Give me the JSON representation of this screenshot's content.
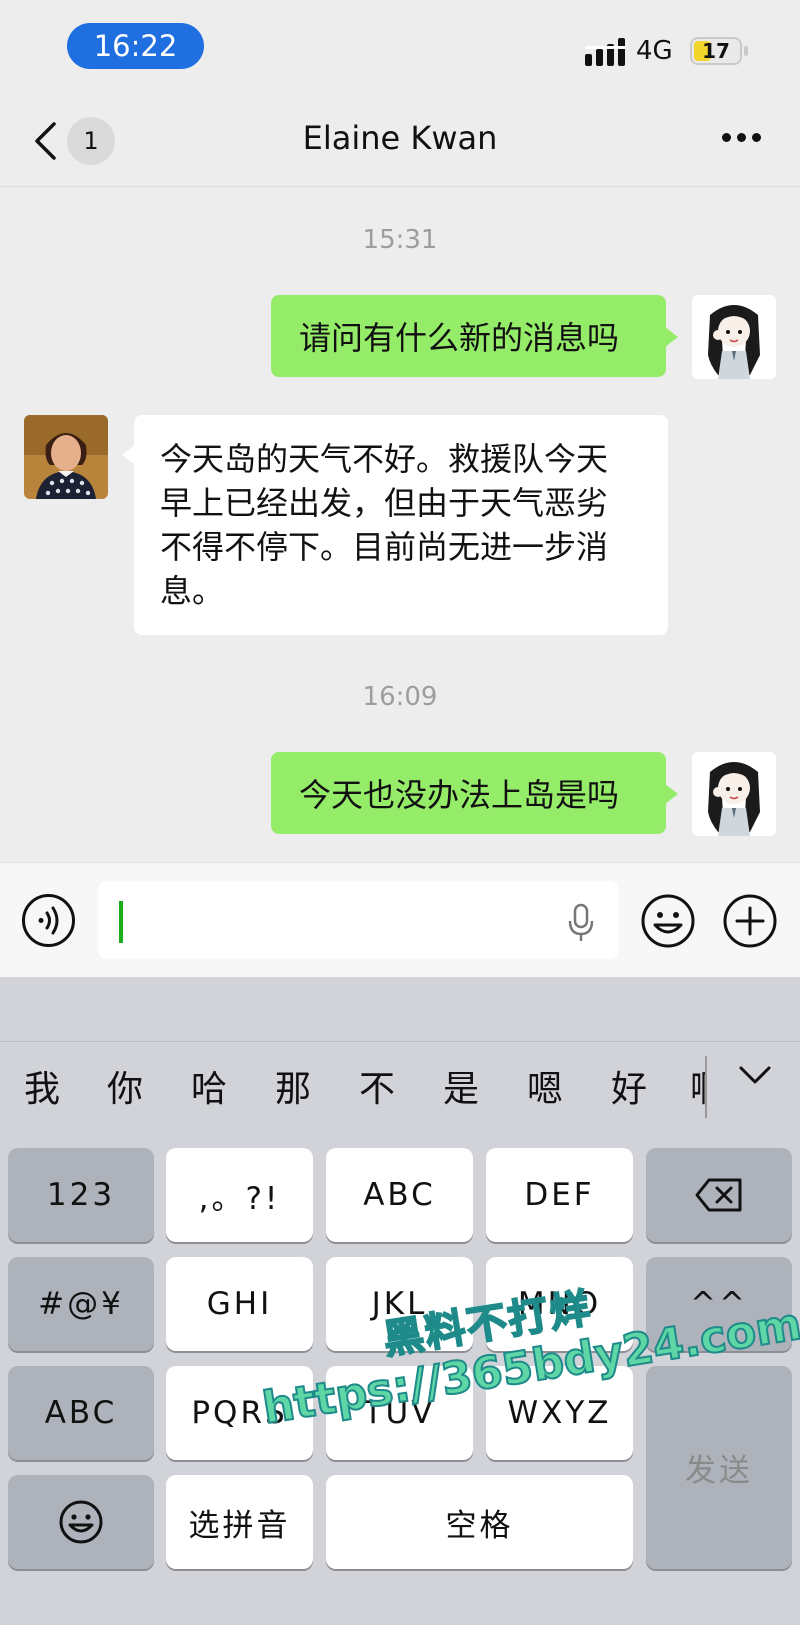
{
  "status_bar": {
    "time": "16:22",
    "network": "4G",
    "battery": "17"
  },
  "nav": {
    "unread_count": "1",
    "title": "Elaine Kwan"
  },
  "messages": [
    {
      "type": "timestamp",
      "text": "15:31"
    },
    {
      "type": "outgoing",
      "text": "请问有什么新的消息吗"
    },
    {
      "type": "incoming",
      "lines": [
        "今天岛的天气不好。救援队今天",
        "早上已经出发，但由于天气恶劣",
        "不得不停下。目前尚无进一步消",
        "息。"
      ]
    },
    {
      "type": "timestamp",
      "text": "16:09"
    },
    {
      "type": "outgoing",
      "text": "今天也没办法上岛是吗"
    }
  ],
  "input": {
    "value": ""
  },
  "keyboard": {
    "candidates": [
      "我",
      "你",
      "哈",
      "那",
      "不",
      "是",
      "嗯",
      "好",
      "啊"
    ],
    "keys": {
      "num": "123",
      "punct": ",。?!",
      "abc": "ABC",
      "def": "DEF",
      "symbols": "#@¥",
      "ghi": "GHI",
      "jkl": "JKL",
      "mno": "MNO",
      "face": "^^",
      "abc_switch": "ABC",
      "pqrs": "PQRS",
      "tuv": "TUV",
      "wxyz": "WXYZ",
      "send": "发送",
      "select_pinyin": "选拼音",
      "space": "空格"
    }
  },
  "watermark": {
    "line1": "黑料不打烊",
    "line2": "https://365bdy24.com"
  },
  "colors": {
    "outgoing_bubble": "#95ec69",
    "time_pill": "#1f6fe0",
    "battery": "#f2d52b"
  }
}
